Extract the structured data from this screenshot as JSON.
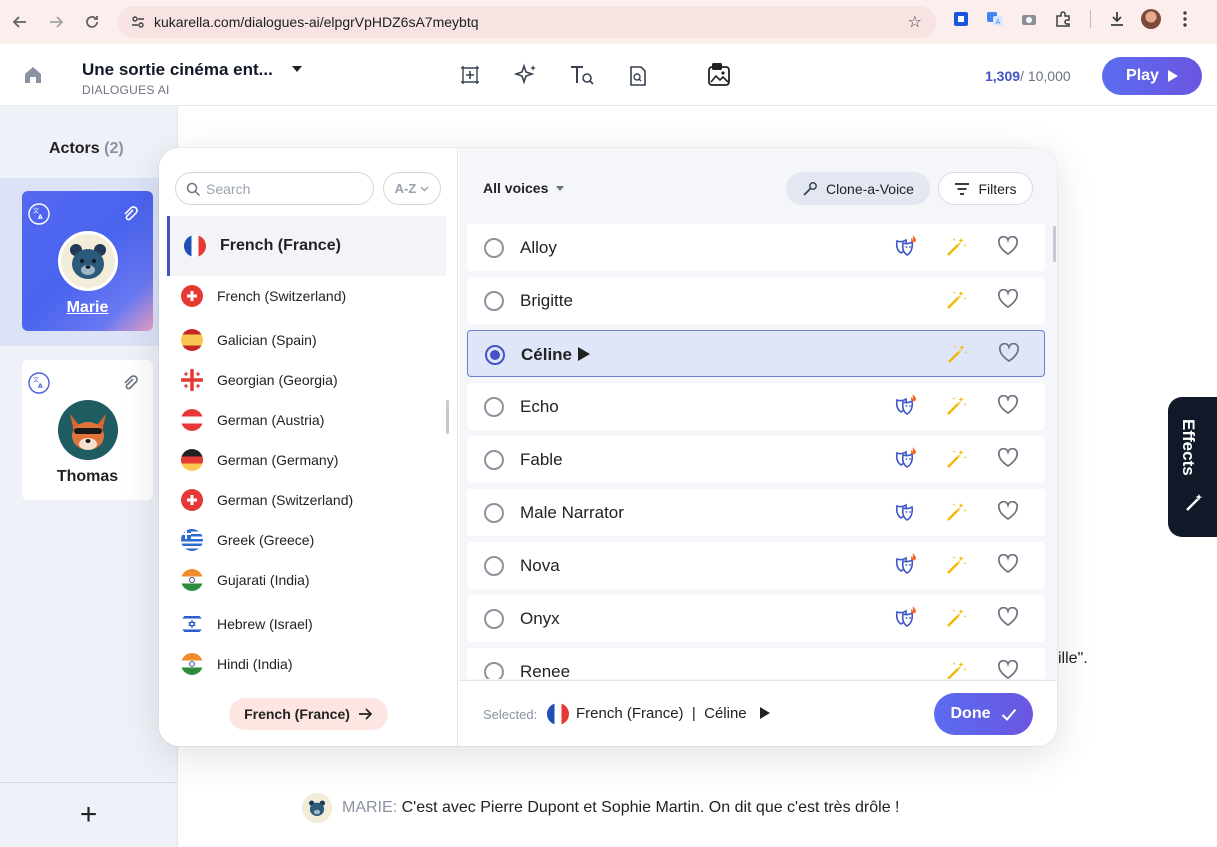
{
  "browser": {
    "url": "kukarella.com/dialogues-ai/elpgrVpHDZ6sA7meybtq"
  },
  "header": {
    "project_title": "Une sortie cinéma ent...",
    "project_subtitle": "DIALOGUES AI",
    "credits_used": "1,309",
    "credits_total": "/ 10,000",
    "play_label": "Play",
    "accent_color": "#5b6cf0"
  },
  "actors": {
    "title": "Actors",
    "count": "(2)",
    "items": [
      {
        "name": "Marie",
        "selected": true
      },
      {
        "name": "Thomas",
        "selected": false
      }
    ],
    "add_label": "+"
  },
  "script": {
    "fragment_right": "ille\".",
    "line_speaker": "MARIE:",
    "line_text": "C'est avec Pierre Dupont et Sophie Martin. On dit que c'est très drôle !"
  },
  "effects_tab": {
    "label": "Effects"
  },
  "language_pane": {
    "search_placeholder": "Search",
    "sort_label": "A-Z",
    "languages": [
      {
        "name": "French (France)",
        "flag": "fr",
        "selected": true
      },
      {
        "name": "French (Switzerland)",
        "flag": "ch"
      },
      {
        "name": "Galician (Spain)",
        "flag": "es"
      },
      {
        "name": "Georgian (Georgia)",
        "flag": "ge"
      },
      {
        "name": "German (Austria)",
        "flag": "at"
      },
      {
        "name": "German (Germany)",
        "flag": "de"
      },
      {
        "name": "German (Switzerland)",
        "flag": "ch"
      },
      {
        "name": "Greek (Greece)",
        "flag": "gr"
      },
      {
        "name": "Gujarati (India)",
        "flag": "in"
      },
      {
        "name": "Hebrew (Israel)",
        "flag": "il"
      },
      {
        "name": "Hindi (India)",
        "flag": "in"
      }
    ],
    "current_chip": "French (France)"
  },
  "voice_pane": {
    "filter_label": "All voices",
    "clone_label": "Clone-a-Voice",
    "filters_label": "Filters",
    "voices": [
      {
        "name": "Alloy",
        "selected": false,
        "mask": "mask-hot"
      },
      {
        "name": "Brigitte",
        "selected": false,
        "mask": ""
      },
      {
        "name": "Céline",
        "selected": true,
        "mask": ""
      },
      {
        "name": "Echo",
        "selected": false,
        "mask": "mask-hot"
      },
      {
        "name": "Fable",
        "selected": false,
        "mask": "mask-hot"
      },
      {
        "name": "Male Narrator",
        "selected": false,
        "mask": "mask"
      },
      {
        "name": "Nova",
        "selected": false,
        "mask": "mask-hot"
      },
      {
        "name": "Onyx",
        "selected": false,
        "mask": "mask-hot"
      },
      {
        "name": "Renee",
        "selected": false,
        "mask": ""
      }
    ],
    "footer": {
      "selected_label": "Selected:",
      "selected_language": "French (France)",
      "separator": "|",
      "selected_voice": "Céline",
      "done_label": "Done"
    }
  }
}
